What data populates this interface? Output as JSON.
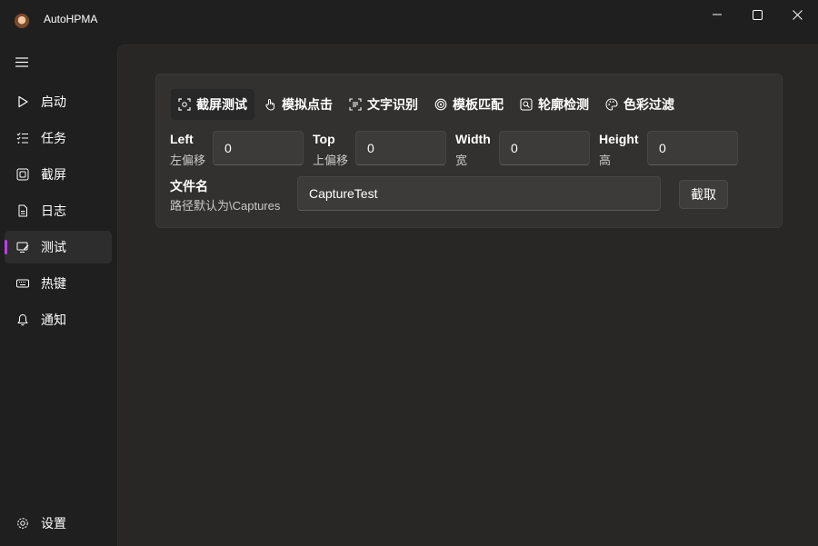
{
  "app": {
    "title": "AutoHPMA"
  },
  "nav": {
    "items": [
      {
        "label": "启动",
        "icon": "play-icon"
      },
      {
        "label": "任务",
        "icon": "task-list-icon"
      },
      {
        "label": "截屏",
        "icon": "screenshot-icon"
      },
      {
        "label": "日志",
        "icon": "document-icon"
      },
      {
        "label": "测试",
        "icon": "test-icon",
        "active": true
      },
      {
        "label": "热键",
        "icon": "keyboard-icon"
      },
      {
        "label": "通知",
        "icon": "bell-icon"
      }
    ],
    "settings": {
      "label": "设置",
      "icon": "gear-icon"
    }
  },
  "tabs": [
    {
      "label": "截屏测试",
      "icon": "capture-icon",
      "active": true
    },
    {
      "label": "模拟点击",
      "icon": "touch-icon"
    },
    {
      "label": "文字识别",
      "icon": "ocr-icon"
    },
    {
      "label": "模板匹配",
      "icon": "target-icon"
    },
    {
      "label": "轮廓检测",
      "icon": "contour-icon"
    },
    {
      "label": "色彩过滤",
      "icon": "palette-icon"
    }
  ],
  "form": {
    "left": {
      "label": "Left",
      "sub": "左偏移",
      "value": "0"
    },
    "top": {
      "label": "Top",
      "sub": "上偏移",
      "value": "0"
    },
    "width": {
      "label": "Width",
      "sub": "宽",
      "value": "0"
    },
    "height": {
      "label": "Height",
      "sub": "高",
      "value": "0"
    },
    "filename": {
      "label": "文件名",
      "sub": "路径默认为\\Captures",
      "value": "CaptureTest"
    },
    "capture_button": "截取"
  },
  "colors": {
    "accent": "#c239ff",
    "window_bg": "#1f1f1f",
    "content_bg": "#282725",
    "card_bg": "#323130"
  }
}
